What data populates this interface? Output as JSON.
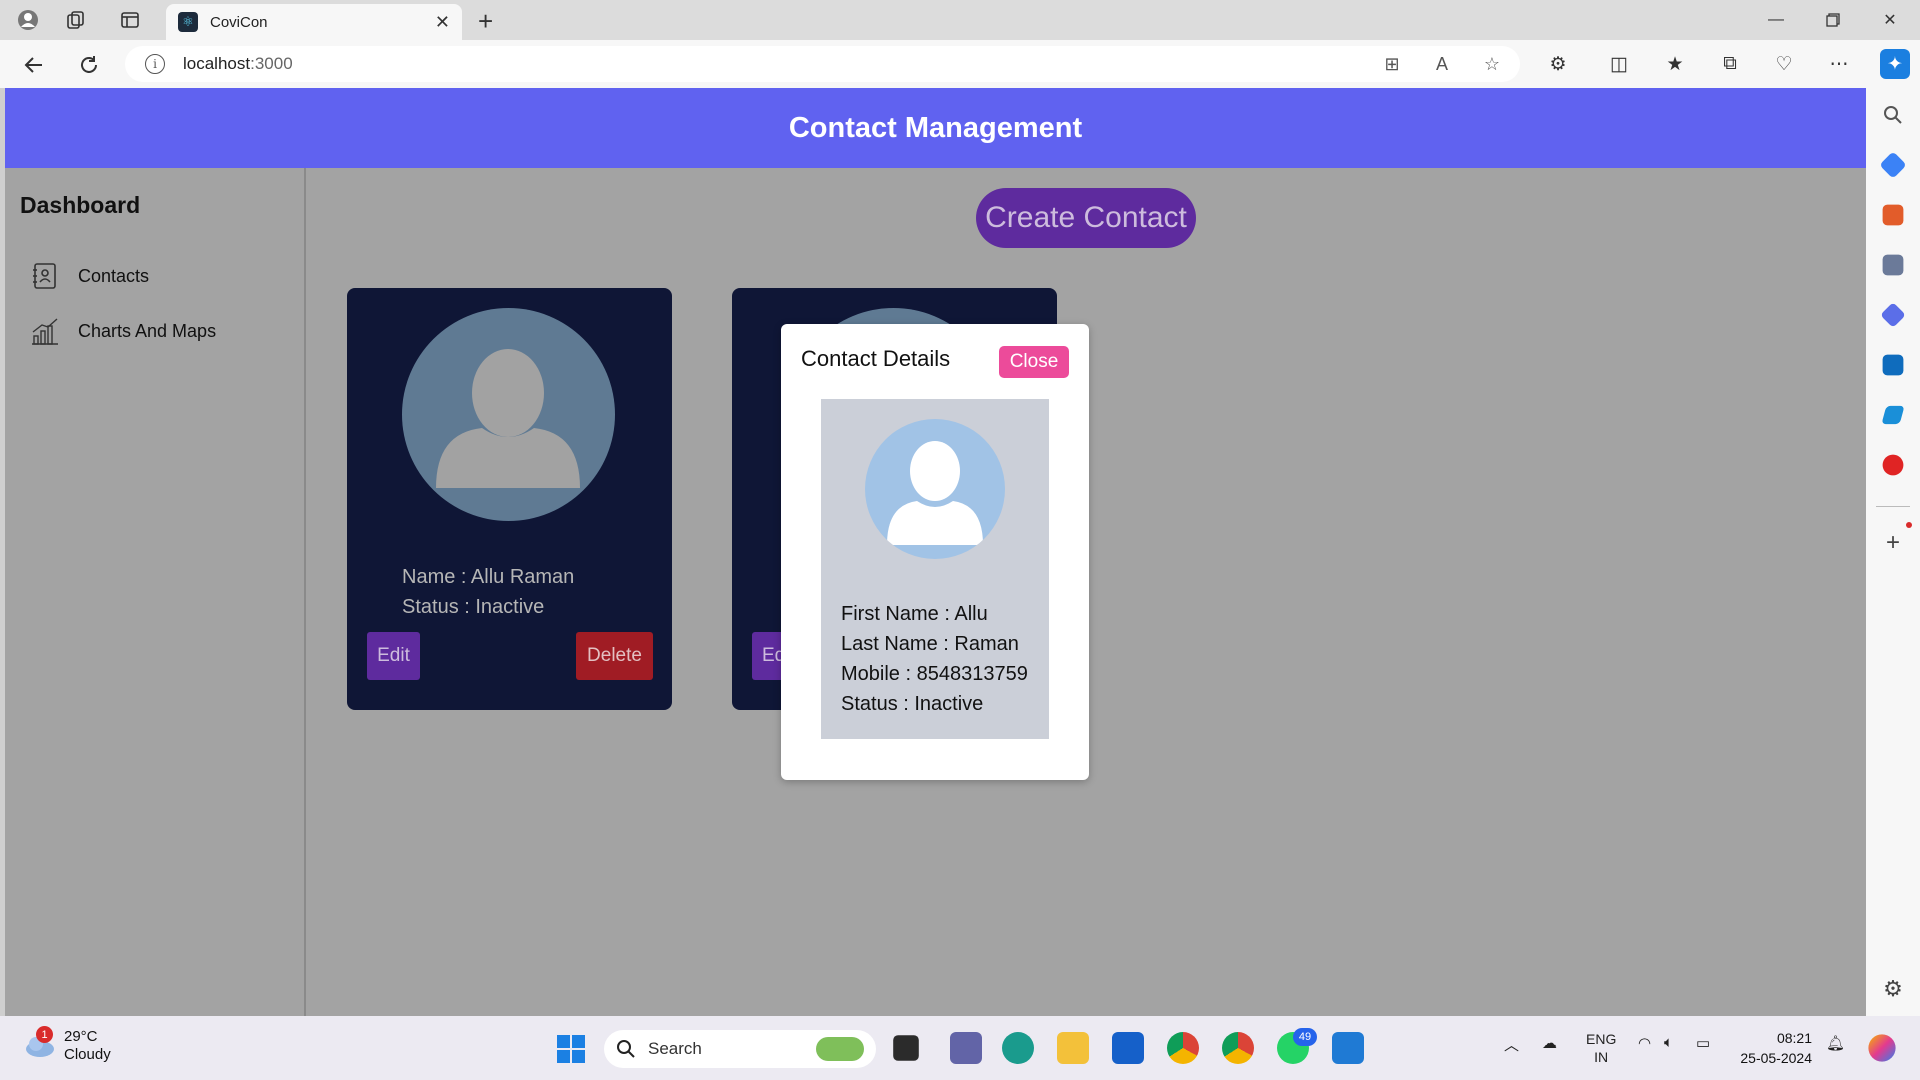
{
  "browser": {
    "tab_title": "CoviCon",
    "url_host": "localhost",
    "url_port": ":3000"
  },
  "app": {
    "header_title": "Contact Management",
    "sidebar": {
      "title": "Dashboard",
      "items": [
        {
          "label": "Contacts",
          "icon": "contacts-book-icon"
        },
        {
          "label": "Charts And Maps",
          "icon": "bar-chart-icon"
        }
      ]
    },
    "create_button": "Create Contact",
    "cards": [
      {
        "name_line": "Name : Allu Raman",
        "status_line": "Status : Inactive",
        "edit_label": "Edit",
        "delete_label": "Delete"
      },
      {
        "edit_label": "Ed"
      }
    ],
    "modal": {
      "title": "Contact Details",
      "close_label": "Close",
      "first_name": "First Name : Allu",
      "last_name": "Last Name : Raman",
      "mobile": "Mobile : 8548313759",
      "status": "Status : Inactive"
    }
  },
  "taskbar": {
    "weather_temp": "29°C",
    "weather_desc": "Cloudy",
    "weather_badge": "1",
    "search_label": "Search",
    "whatsapp_badge": "49",
    "lang_top": "ENG",
    "lang_bottom": "IN",
    "time": "08:21",
    "date": "25-05-2024"
  },
  "colors": {
    "header": "#6062f0",
    "page_bg": "#a3a3a3",
    "card_bg": "#0f1636",
    "purple_button": "#5e2b9e",
    "delete_button": "#a01c24",
    "close_button": "#ec4b9a"
  }
}
